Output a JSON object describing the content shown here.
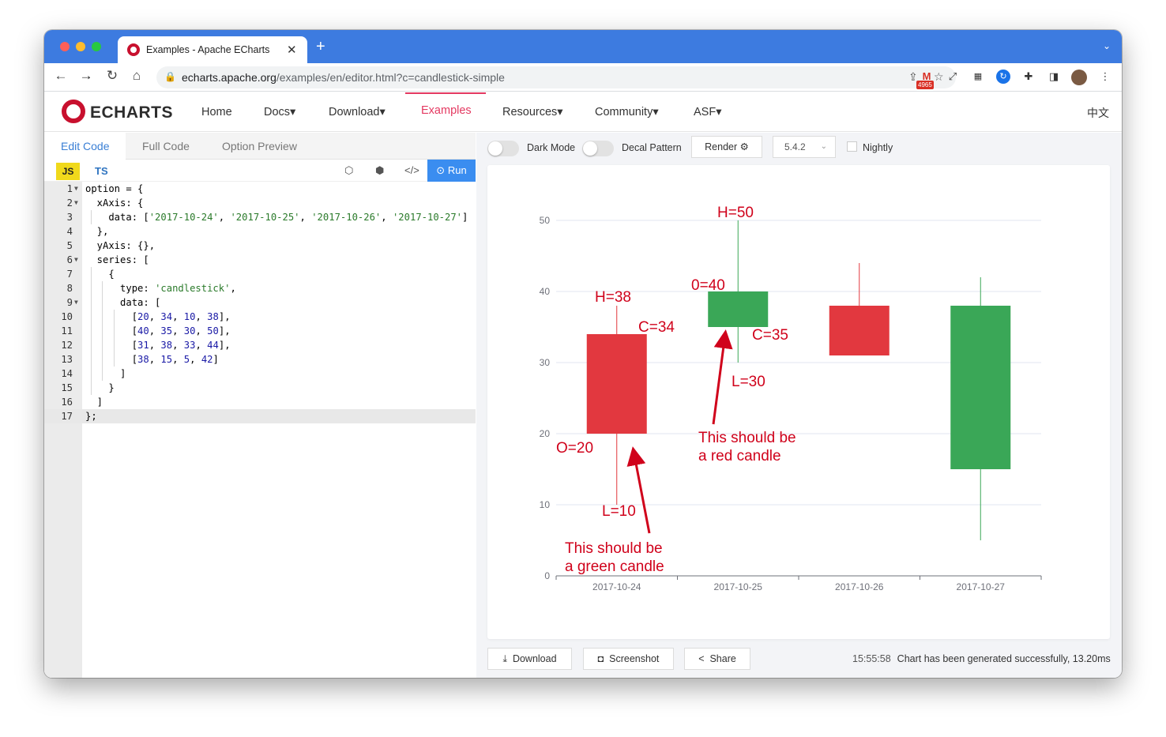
{
  "browser": {
    "tab_title": "Examples - Apache ECharts",
    "tab_close": "✕",
    "new_tab": "+",
    "url_host": "echarts.apache.org",
    "url_path": "/examples/en/editor.html?c=candlestick-simple",
    "gmail_count": "4965"
  },
  "site": {
    "brand": "ECHARTS",
    "nav": [
      "Home",
      "Docs▾",
      "Download▾",
      "Examples",
      "Resources▾",
      "Community▾",
      "ASF▾"
    ],
    "active_nav": "Examples",
    "lang": "中文"
  },
  "editor": {
    "tabs": [
      "Edit Code",
      "Full Code",
      "Option Preview"
    ],
    "active_tab": "Edit Code",
    "js_label": "JS",
    "ts_label": "TS",
    "run_label": "Run",
    "lines": [
      "option = {",
      "  xAxis: {",
      "    data: ['2017-10-24', '2017-10-25', '2017-10-26', '2017-10-27']",
      "  },",
      "  yAxis: {},",
      "  series: [",
      "    {",
      "      type: 'candlestick',",
      "      data: [",
      "        [20, 34, 10, 38],",
      "        [40, 35, 30, 50],",
      "        [31, 38, 33, 44],",
      "        [38, 15, 5, 42]",
      "      ]",
      "    }",
      "  ]",
      "};"
    ]
  },
  "preview": {
    "dark_mode_label": "Dark Mode",
    "decal_label": "Decal Pattern",
    "render_label": "Render ⚙",
    "version": "5.4.2",
    "nightly_label": "Nightly",
    "download_label": "Download",
    "screenshot_label": "Screenshot",
    "share_label": "Share",
    "status_time": "15:55:58",
    "status_text": "Chart has been generated successfully, 13.20ms"
  },
  "chart_data": {
    "type": "candlestick",
    "categories": [
      "2017-10-24",
      "2017-10-25",
      "2017-10-26",
      "2017-10-27"
    ],
    "values": [
      [
        20,
        34,
        10,
        38
      ],
      [
        40,
        35,
        30,
        50
      ],
      [
        31,
        38,
        33,
        44
      ],
      [
        38,
        15,
        5,
        42
      ]
    ],
    "ylim": [
      0,
      50
    ],
    "yticks": [
      0,
      10,
      20,
      30,
      40,
      50
    ],
    "grid": true,
    "colors": {
      "up": "#e2383f",
      "down": "#3aa757",
      "axis": "#6e7079",
      "grid": "#e0e6f1",
      "annotation": "#d0021b"
    },
    "annotations": {
      "c1_high": "H=38",
      "c1_close": "C=34",
      "c1_open": "O=20",
      "c1_low": "L=10",
      "c1_note": [
        "This should be",
        "a green candle"
      ],
      "c2_high": "H=50",
      "c2_open": "0=40",
      "c2_close": "C=35",
      "c2_low": "L=30",
      "c2_note": [
        "This should be",
        "a red candle"
      ]
    }
  },
  "colors": {
    "browser_chrome": "#3d7be0",
    "accent_nav": "#e43961",
    "run_button": "#3a8df0"
  }
}
